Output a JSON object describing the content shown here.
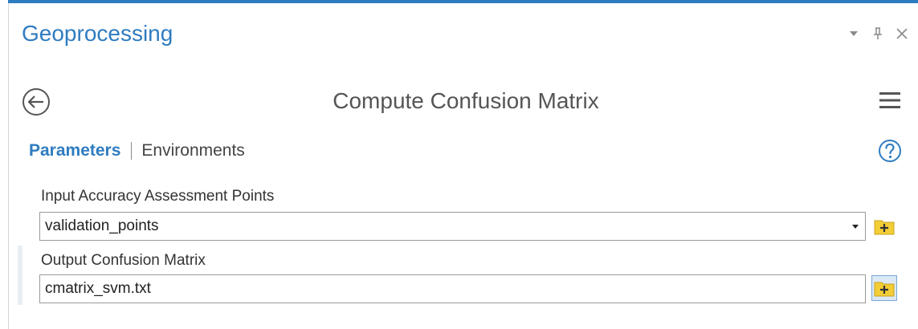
{
  "window": {
    "title": "Geoprocessing",
    "controls": {
      "options_icon": "chevron-down-icon",
      "pin_icon": "pin-icon",
      "close_icon": "close-icon"
    }
  },
  "tool": {
    "name": "Compute Confusion Matrix",
    "back_icon": "back-arrow-icon",
    "menu_icon": "hamburger-menu-icon"
  },
  "tabs": [
    {
      "label": "Parameters",
      "active": true
    },
    {
      "label": "Environments",
      "active": false
    }
  ],
  "help_icon": "help-icon",
  "parameters": [
    {
      "label": "Input Accuracy Assessment Points",
      "value": "validation_points",
      "has_dropdown": true,
      "browse_icon": "browse-folder-icon"
    },
    {
      "label": "Output Confusion Matrix",
      "value": "cmatrix_svm.txt",
      "has_dropdown": false,
      "browse_icon": "browse-folder-icon"
    }
  ],
  "colors": {
    "accent": "#2f7cc0",
    "browse_icon_fill": "#f2cd36"
  }
}
